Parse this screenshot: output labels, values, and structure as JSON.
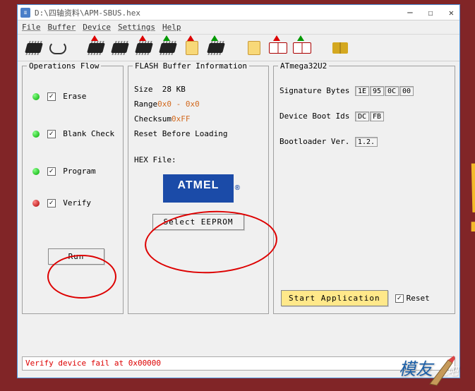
{
  "window": {
    "title": "D:\\四轴资料\\APM-SBUS.hex"
  },
  "menu": {
    "file": "File",
    "buffer": "Buffer",
    "device": "Device",
    "settings": "Settings",
    "help": "Help"
  },
  "ops": {
    "legend": "Operations Flow",
    "erase": "Erase",
    "blank": "Blank Check",
    "program": "Program",
    "verify": "Verify",
    "run": "Run"
  },
  "flash": {
    "legend": "FLASH Buffer Information",
    "size_label": "Size",
    "size_val": "28 KB",
    "range_label": "Range",
    "range_val": "0x0 - 0x0",
    "checksum_label": "Checksum",
    "checksum_val": "0xFF",
    "reset": "Reset Before Loading",
    "hex_label": "HEX File:",
    "logo": "ATMEL",
    "select": "Select EEPROM"
  },
  "chip": {
    "legend": "ATmega32U2",
    "sig_label": "Signature Bytes",
    "sig": [
      "1E",
      "95",
      "0C",
      "00"
    ],
    "boot_label": "Device Boot Ids",
    "boot": [
      "DC",
      "FB"
    ],
    "bl_label": "Bootloader Ver.",
    "bl_val": "1.2.",
    "start": "Start Application",
    "reset": "Reset"
  },
  "status": "Verify device fail at 0x00000",
  "watermark": {
    "a": "模友",
    "b": "之吧"
  }
}
